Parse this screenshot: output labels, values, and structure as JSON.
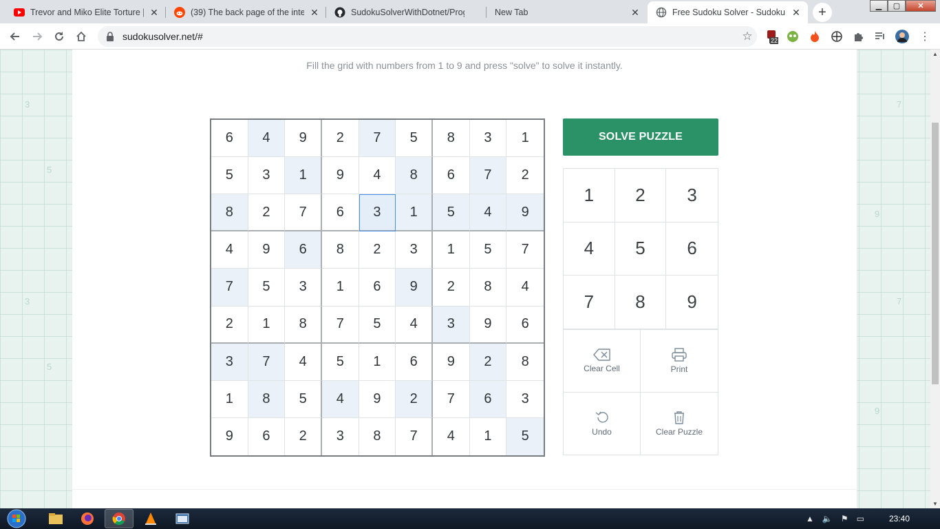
{
  "browser": {
    "tabs": [
      {
        "title": "Trevor and Miko Elite Torture | C",
        "icon": "youtube-icon"
      },
      {
        "title": "(39) The back page of the intern",
        "icon": "reddit-icon"
      },
      {
        "title": "SudokuSolverWithDotnet/Progr",
        "icon": "github-icon"
      },
      {
        "title": "New Tab",
        "icon": "none"
      },
      {
        "title": "Free Sudoku Solver - SudokuSo",
        "icon": "globe-icon",
        "active": true
      }
    ],
    "new_tab_label": "+",
    "url": "sudokusolver.net/#",
    "extension_badge": "22"
  },
  "page": {
    "subtitle": "Fill the grid with numbers from 1 to 9 and press \"solve\" to solve it instantly.",
    "background_numbers": [
      "3",
      "5",
      "3",
      "5",
      "7",
      "9",
      "7",
      "9"
    ],
    "grid": [
      [
        "6",
        "4",
        "9",
        "2",
        "7",
        "5",
        "8",
        "3",
        "1"
      ],
      [
        "5",
        "3",
        "1",
        "9",
        "4",
        "8",
        "6",
        "7",
        "2"
      ],
      [
        "8",
        "2",
        "7",
        "6",
        "3",
        "1",
        "5",
        "4",
        "9"
      ],
      [
        "4",
        "9",
        "6",
        "8",
        "2",
        "3",
        "1",
        "5",
        "7"
      ],
      [
        "7",
        "5",
        "3",
        "1",
        "6",
        "9",
        "2",
        "8",
        "4"
      ],
      [
        "2",
        "1",
        "8",
        "7",
        "5",
        "4",
        "3",
        "9",
        "6"
      ],
      [
        "3",
        "7",
        "4",
        "5",
        "1",
        "6",
        "9",
        "2",
        "8"
      ],
      [
        "1",
        "8",
        "5",
        "4",
        "9",
        "2",
        "7",
        "6",
        "3"
      ],
      [
        "9",
        "6",
        "2",
        "3",
        "8",
        "7",
        "4",
        "1",
        "5"
      ]
    ],
    "selected_cell": [
      2,
      4
    ],
    "solve_button": "SOLVE PUZZLE",
    "numpad": [
      "1",
      "2",
      "3",
      "4",
      "5",
      "6",
      "7",
      "8",
      "9"
    ],
    "actions": {
      "clear_cell": "Clear Cell",
      "print": "Print",
      "undo": "Undo",
      "clear_puzzle": "Clear Puzzle"
    },
    "accent_color": "#2a9266"
  },
  "taskbar": {
    "clock": "23:40"
  }
}
